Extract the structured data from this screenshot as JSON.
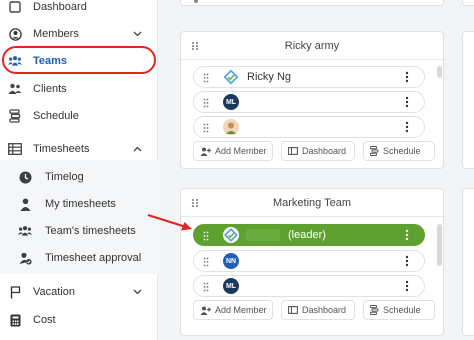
{
  "sidebar": {
    "items": [
      {
        "label": "Dashboard",
        "icon": "dashboard-icon"
      },
      {
        "label": "Members",
        "icon": "members-icon"
      },
      {
        "label": "Teams",
        "icon": "teams-icon"
      },
      {
        "label": "Clients",
        "icon": "clients-icon"
      },
      {
        "label": "Schedule",
        "icon": "schedule-icon"
      },
      {
        "label": "Timesheets",
        "icon": "timesheets-icon"
      },
      {
        "label": "Timelog",
        "icon": "timelog-icon"
      },
      {
        "label": "My timesheets",
        "icon": "person-icon"
      },
      {
        "label": "Team's timesheets",
        "icon": "team-icon"
      },
      {
        "label": "Timesheet approval",
        "icon": "approval-icon"
      },
      {
        "label": "Vacation",
        "icon": "flag-icon"
      },
      {
        "label": "Cost",
        "icon": "cost-icon"
      }
    ]
  },
  "teams": [
    {
      "name": "Ricky army",
      "members": [
        {
          "name": "Ricky Ng",
          "initials": "",
          "avatar": "logo"
        },
        {
          "name": "",
          "initials": "ML",
          "avatar": "initials"
        },
        {
          "name": "",
          "initials": "",
          "avatar": "photo"
        }
      ]
    },
    {
      "name": "Marketing Team",
      "members": [
        {
          "name": "(leader)",
          "initials": "",
          "avatar": "logo",
          "leader": true
        },
        {
          "name": "",
          "initials": "NN",
          "avatar": "initials"
        },
        {
          "name": "",
          "initials": "ML",
          "avatar": "initials"
        }
      ]
    }
  ],
  "actions": {
    "add_member": "Add Member",
    "dashboard": "Dashboard",
    "schedule": "Schedule"
  },
  "colors": {
    "accent": "#1f5fb4",
    "leader_green": "#5ea12e",
    "highlight_red": "#e02424"
  }
}
